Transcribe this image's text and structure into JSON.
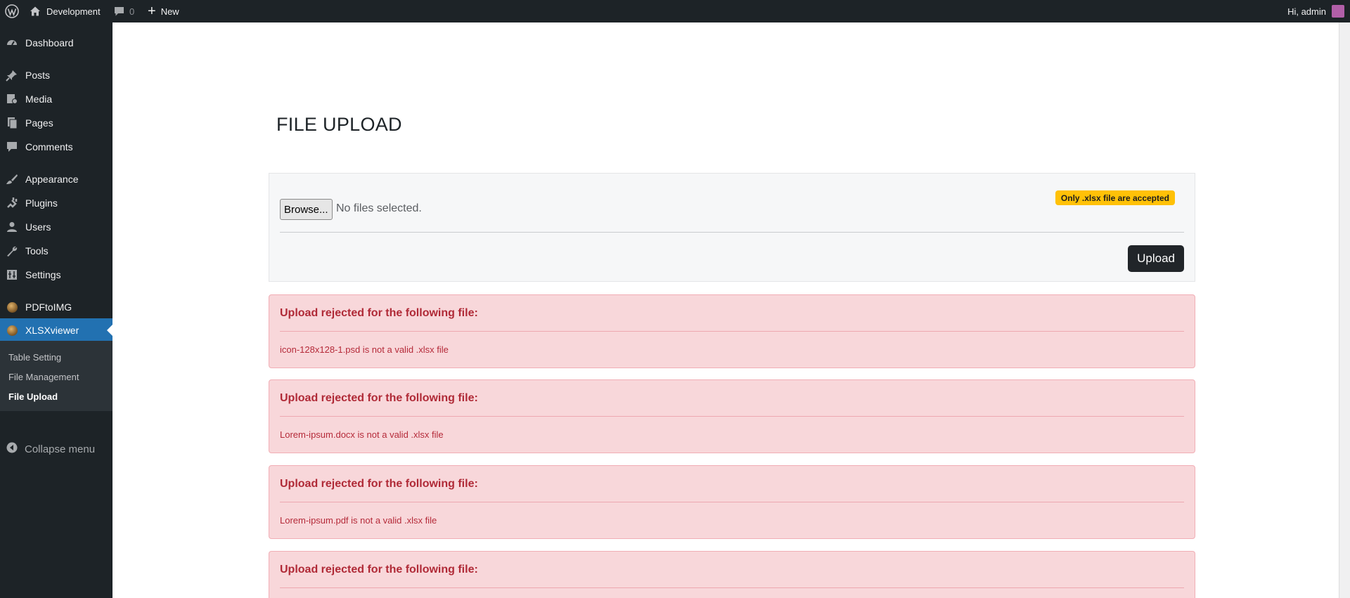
{
  "admin_bar": {
    "site_name": "Development",
    "comments_count": "0",
    "new_label": "New",
    "greeting": "Hi, admin"
  },
  "sidebar": {
    "items": [
      {
        "label": "Dashboard",
        "icon": "dashboard-icon"
      },
      {
        "label": "Posts",
        "icon": "pin-icon"
      },
      {
        "label": "Media",
        "icon": "media-icon"
      },
      {
        "label": "Pages",
        "icon": "pages-icon"
      },
      {
        "label": "Comments",
        "icon": "comment-icon"
      },
      {
        "label": "Appearance",
        "icon": "brush-icon"
      },
      {
        "label": "Plugins",
        "icon": "plug-icon"
      },
      {
        "label": "Users",
        "icon": "user-icon"
      },
      {
        "label": "Tools",
        "icon": "wrench-icon"
      },
      {
        "label": "Settings",
        "icon": "settings-icon"
      },
      {
        "label": "PDFtoIMG",
        "icon": "plugin-logo-icon"
      },
      {
        "label": "XLSXviewer",
        "icon": "plugin-logo-icon",
        "current": true
      }
    ],
    "submenu": [
      {
        "label": "Table Setting"
      },
      {
        "label": "File Management"
      },
      {
        "label": "File Upload",
        "current": true
      }
    ],
    "collapse_label": "Collapse menu"
  },
  "main": {
    "title": "FILE UPLOAD",
    "upload_card": {
      "browse_label": "Browse...",
      "file_status": "No files selected.",
      "badge": "Only .xlsx file are accepted",
      "upload_label": "Upload"
    },
    "alerts": [
      {
        "heading": "Upload rejected for the following file:",
        "message": "icon-128x128-1.psd is not a valid .xlsx file"
      },
      {
        "heading": "Upload rejected for the following file:",
        "message": "Lorem-ipsum.docx is not a valid .xlsx file"
      },
      {
        "heading": "Upload rejected for the following file:",
        "message": "Lorem-ipsum.pdf is not a valid .xlsx file"
      },
      {
        "heading": "Upload rejected for the following file:",
        "message": ""
      }
    ]
  },
  "colors": {
    "admin_bar_bg": "#1d2327",
    "menu_current_bg": "#2271b1",
    "alert_bg": "#f8d7da",
    "alert_text": "#b02a37",
    "badge_bg": "#ffc107",
    "button_dark": "#212529"
  }
}
